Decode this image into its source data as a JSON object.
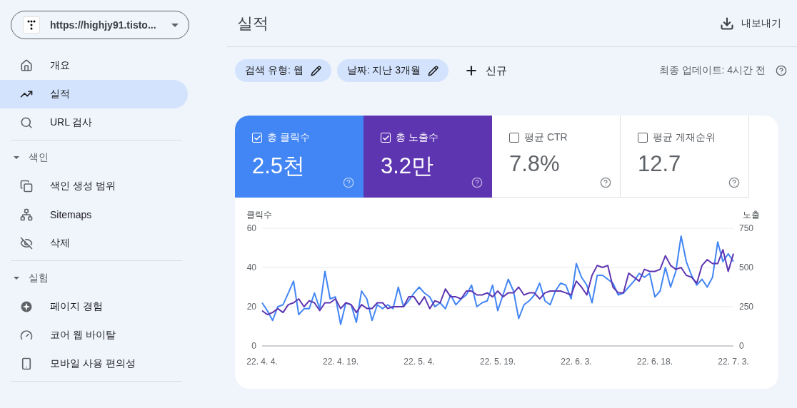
{
  "property_selector": {
    "url": "https://highjy91.tisto..."
  },
  "sidebar": {
    "items": [
      {
        "label": "개요",
        "selected": false
      },
      {
        "label": "실적",
        "selected": true
      },
      {
        "label": "URL 검사",
        "selected": false
      }
    ],
    "sections": [
      {
        "title": "색인",
        "expanded": true,
        "items": [
          {
            "label": "색인 생성 범위",
            "selected": false
          },
          {
            "label": "Sitemaps",
            "selected": false
          },
          {
            "label": "삭제",
            "selected": false
          }
        ]
      },
      {
        "title": "실험",
        "expanded": true,
        "items": [
          {
            "label": "페이지 경험",
            "selected": false
          },
          {
            "label": "코어 웹 바이탈",
            "selected": false
          },
          {
            "label": "모바일 사용 편의성",
            "selected": false
          }
        ]
      }
    ]
  },
  "header": {
    "title": "실적",
    "export": "내보내기"
  },
  "filters": {
    "chips": [
      {
        "label": "검색 유형: 웹"
      },
      {
        "label": "날짜: 지난 3개월"
      }
    ],
    "new": "신규",
    "updated": "최종 업데이트: 4시간 전"
  },
  "metrics": [
    {
      "label": "총 클릭수",
      "value": "2.5천",
      "checked": true,
      "color": "#4285f4"
    },
    {
      "label": "총 노출수",
      "value": "3.2만",
      "checked": true,
      "color": "#5e35b1"
    },
    {
      "label": "평균 CTR",
      "value": "7.8%",
      "checked": false
    },
    {
      "label": "평균 게재순위",
      "value": "12.7",
      "checked": false
    }
  ],
  "chart_data": {
    "type": "line",
    "categories": [
      "22. 4. 4.",
      null,
      null,
      null,
      null,
      null,
      null,
      null,
      null,
      null,
      null,
      null,
      null,
      null,
      null,
      "22. 4. 19.",
      null,
      null,
      null,
      null,
      null,
      null,
      null,
      null,
      null,
      null,
      null,
      null,
      null,
      null,
      "22. 5. 4.",
      null,
      null,
      null,
      null,
      null,
      null,
      null,
      null,
      null,
      null,
      null,
      null,
      null,
      null,
      "22. 5. 19.",
      null,
      null,
      null,
      null,
      null,
      null,
      null,
      null,
      null,
      null,
      null,
      null,
      null,
      null,
      "22. 6. 3.",
      null,
      null,
      null,
      null,
      null,
      null,
      null,
      null,
      null,
      null,
      null,
      null,
      null,
      null,
      "22. 6. 18.",
      null,
      null,
      null,
      null,
      null,
      null,
      null,
      null,
      null,
      null,
      null,
      null,
      null,
      null,
      "22. 7. 3."
    ],
    "ylabel": "클릭수",
    "y2label": "노출",
    "ylim": [
      0,
      60
    ],
    "y2lim": [
      0,
      750
    ],
    "yticks": [
      0,
      20,
      40,
      60
    ],
    "y2ticks": [
      0,
      250,
      500,
      750
    ],
    "series": [
      {
        "color": "#4285f4",
        "axis": "y",
        "values": [
          22,
          18,
          13,
          20,
          21,
          27,
          33,
          16,
          19,
          19,
          27,
          19,
          38,
          24,
          25,
          11,
          22,
          21,
          12,
          28,
          24,
          13,
          21,
          19,
          21,
          19,
          30,
          20,
          23,
          27,
          30,
          27,
          25,
          20,
          22,
          19,
          26,
          21,
          24,
          26,
          31,
          20,
          22,
          23,
          31,
          18,
          26,
          34,
          28,
          14,
          21,
          23,
          26,
          32,
          23,
          21,
          28,
          32,
          31,
          24,
          42,
          35,
          31,
          22,
          36,
          36,
          34,
          32,
          26,
          27,
          30,
          33,
          37,
          35,
          37,
          25,
          28,
          40,
          30,
          38,
          56,
          43,
          36,
          31,
          34,
          30,
          35,
          53,
          43,
          47,
          43
        ]
      },
      {
        "color": "#5e35b1",
        "axis": "y2",
        "values": [
          225,
          200,
          213,
          238,
          213,
          263,
          275,
          300,
          250,
          288,
          275,
          225,
          275,
          275,
          300,
          238,
          275,
          263,
          213,
          263,
          238,
          238,
          275,
          275,
          238,
          250,
          250,
          250,
          313,
          313,
          263,
          313,
          238,
          288,
          275,
          363,
          313,
          313,
          300,
          350,
          350,
          325,
          325,
          338,
          313,
          350,
          313,
          338,
          338,
          375,
          325,
          338,
          338,
          300,
          338,
          350,
          350,
          350,
          338,
          325,
          413,
          375,
          325,
          450,
          513,
          500,
          513,
          375,
          338,
          338,
          463,
          438,
          413,
          488,
          475,
          475,
          488,
          575,
          513,
          488,
          500,
          450,
          438,
          400,
          513,
          550,
          525,
          525,
          613,
          475,
          588
        ]
      }
    ]
  }
}
